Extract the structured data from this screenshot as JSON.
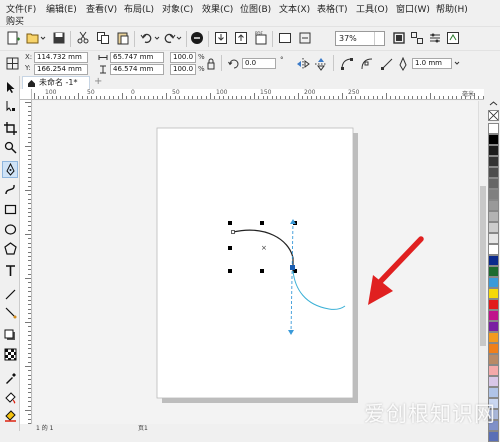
{
  "menubar": {
    "items": [
      "文件(F)",
      "编辑(E)",
      "查看(V)",
      "布局(L)",
      "对象(C)",
      "效果(C)",
      "位图(B)",
      "文本(X)",
      "表格(T)",
      "工具(O)",
      "窗口(W)",
      "帮助(H)"
    ],
    "second_row": "购买"
  },
  "toolbar": {
    "zoom_value": "37%"
  },
  "propbar": {
    "x_label": "X:",
    "x_value": "114.732 mm",
    "y_label": "Y:",
    "y_value": "166.254 mm",
    "width_value": "65.747 mm",
    "height_value": "46.574 mm",
    "scale_w": "100.0",
    "scale_h": "100.0",
    "percent": "%",
    "rotation_value": "0.0",
    "rotation_unit": "°",
    "outline_width": "1.0 mm"
  },
  "tab": {
    "title": "未命名 -1*"
  },
  "ruler": {
    "ticks": [
      "100",
      "50",
      "0",
      "50",
      "100",
      "150",
      "200",
      "250"
    ],
    "unit": "毫米"
  },
  "palette": {
    "colors": [
      "#ffffff",
      "#000000",
      "#1c1c1c",
      "#333333",
      "#4d4d4d",
      "#666666",
      "#808080",
      "#999999",
      "#b3b3b3",
      "#cccccc",
      "#e6e6e6",
      "#ffffff",
      "#0a2a8c",
      "#1d6b2e",
      "#3a9ad9",
      "#f5d90a",
      "#e21b1b",
      "#c0128b",
      "#7a1fa2",
      "#f39a1e",
      "#f07f1a",
      "#b88a66",
      "#f4a9a9",
      "#d8c7e8",
      "#b0c4e8",
      "#c9d6f0",
      "#a9b7d9",
      "#7f90c8",
      "#5a6fb6"
    ]
  },
  "statusbar": {
    "page_text": "1 的 1",
    "page_label": "页1"
  },
  "watermark": {
    "text": "爱创根知识网"
  }
}
